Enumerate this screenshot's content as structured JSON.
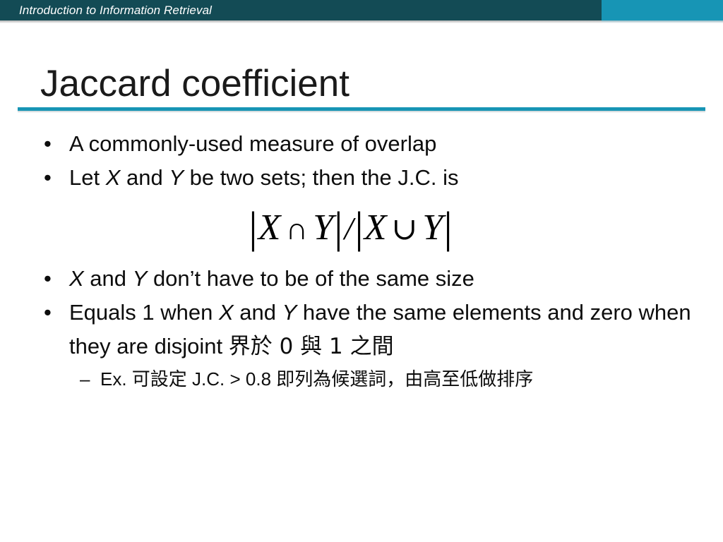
{
  "header": {
    "title": "Introduction to Information Retrieval",
    "bg_color": "#134b55",
    "accent_color": "#1795b5"
  },
  "slide": {
    "title": "Jaccard coefficient",
    "rule_color": "#1795b5"
  },
  "content": {
    "bullet_marker": "•",
    "sub_marker": "–",
    "bullets": [
      {
        "id": "overlap-measure",
        "text": "A commonly-used measure of overlap"
      },
      {
        "id": "two-sets",
        "pre": "Let ",
        "var1": "X",
        "mid": " and ",
        "var2": "Y",
        "post": " be two sets; then the J.C. is"
      },
      {
        "id": "same-size",
        "var1": "X",
        "mid": " and ",
        "var2": "Y",
        "post": " don’t have to be of the same size"
      },
      {
        "id": "equals-one",
        "pre": "Equals 1 when ",
        "var1": "X",
        "mid": " and ",
        "var2": "Y",
        "post": " have the same elements and zero when they are disjoint ",
        "cjk": "界於 0 與 1 之間"
      }
    ],
    "sub_bullets": [
      {
        "id": "example-threshold",
        "pre": "Ex. ",
        "cjk1": "可設定",
        "mid": " J.C. > 0.8 ",
        "cjk2": "即列為候選詞，由高至低做排序"
      }
    ]
  },
  "formula": {
    "full": "|X ∩ Y| / |X ∪ Y|",
    "bar_open_1": "|",
    "var_x1": "X",
    "intersect": "∩",
    "var_y1": "Y",
    "bar_close_1": "|",
    "slash": "/",
    "bar_open_2": "|",
    "var_x2": "X",
    "union": "∪",
    "var_y2": "Y",
    "bar_close_2": "|"
  }
}
